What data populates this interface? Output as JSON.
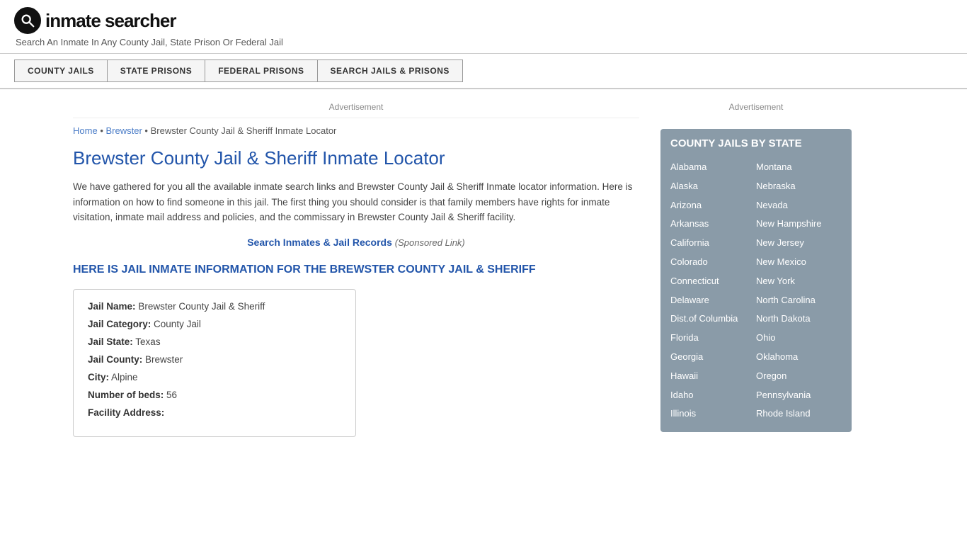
{
  "header": {
    "logo_text": "inmate searcher",
    "tagline": "Search An Inmate In Any County Jail, State Prison Or Federal Jail"
  },
  "nav": {
    "items": [
      {
        "label": "COUNTY JAILS",
        "id": "county-jails"
      },
      {
        "label": "STATE PRISONS",
        "id": "state-prisons"
      },
      {
        "label": "FEDERAL PRISONS",
        "id": "federal-prisons"
      },
      {
        "label": "SEARCH JAILS & PRISONS",
        "id": "search-jails"
      }
    ]
  },
  "ad_label": "Advertisement",
  "breadcrumb": {
    "home": "Home",
    "separator": "•",
    "middle": "Brewster",
    "current": "Brewster County Jail & Sheriff Inmate Locator"
  },
  "page_title": "Brewster County Jail & Sheriff Inmate Locator",
  "description": "We have gathered for you all the available inmate search links and Brewster County Jail & Sheriff Inmate locator information. Here is information on how to find someone in this jail. The first thing you should consider is that family members have rights for inmate visitation, inmate mail address and policies, and the commissary in Brewster County Jail & Sheriff facility.",
  "sponsored": {
    "link_text": "Search Inmates & Jail Records",
    "note": "(Sponsored Link)"
  },
  "info_heading": "HERE IS JAIL INMATE INFORMATION FOR THE BREWSTER COUNTY JAIL & SHERIFF",
  "jail_info": {
    "name_label": "Jail Name:",
    "name_value": "Brewster County Jail & Sheriff",
    "category_label": "Jail Category:",
    "category_value": "County Jail",
    "state_label": "Jail State:",
    "state_value": "Texas",
    "county_label": "Jail County:",
    "county_value": "Brewster",
    "city_label": "City:",
    "city_value": "Alpine",
    "beds_label": "Number of beds:",
    "beds_value": "56",
    "address_label": "Facility Address:"
  },
  "sidebar": {
    "ad_label": "Advertisement",
    "state_list_title": "COUNTY JAILS BY STATE",
    "states_left": [
      "Alabama",
      "Alaska",
      "Arizona",
      "Arkansas",
      "California",
      "Colorado",
      "Connecticut",
      "Delaware",
      "Dist.of Columbia",
      "Florida",
      "Georgia",
      "Hawaii",
      "Idaho",
      "Illinois"
    ],
    "states_right": [
      "Montana",
      "Nebraska",
      "Nevada",
      "New Hampshire",
      "New Jersey",
      "New Mexico",
      "New York",
      "North Carolina",
      "North Dakota",
      "Ohio",
      "Oklahoma",
      "Oregon",
      "Pennsylvania",
      "Rhode Island"
    ]
  }
}
